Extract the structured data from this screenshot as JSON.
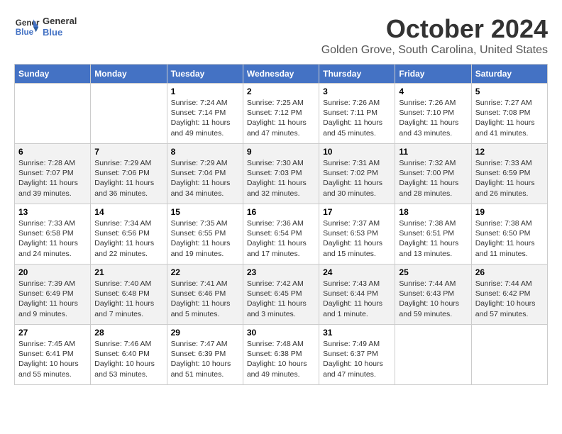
{
  "header": {
    "logo_line1": "General",
    "logo_line2": "Blue",
    "month": "October 2024",
    "location": "Golden Grove, South Carolina, United States"
  },
  "weekdays": [
    "Sunday",
    "Monday",
    "Tuesday",
    "Wednesday",
    "Thursday",
    "Friday",
    "Saturday"
  ],
  "weeks": [
    [
      {
        "day": "",
        "info": ""
      },
      {
        "day": "",
        "info": ""
      },
      {
        "day": "1",
        "info": "Sunrise: 7:24 AM\nSunset: 7:14 PM\nDaylight: 11 hours and 49 minutes."
      },
      {
        "day": "2",
        "info": "Sunrise: 7:25 AM\nSunset: 7:12 PM\nDaylight: 11 hours and 47 minutes."
      },
      {
        "day": "3",
        "info": "Sunrise: 7:26 AM\nSunset: 7:11 PM\nDaylight: 11 hours and 45 minutes."
      },
      {
        "day": "4",
        "info": "Sunrise: 7:26 AM\nSunset: 7:10 PM\nDaylight: 11 hours and 43 minutes."
      },
      {
        "day": "5",
        "info": "Sunrise: 7:27 AM\nSunset: 7:08 PM\nDaylight: 11 hours and 41 minutes."
      }
    ],
    [
      {
        "day": "6",
        "info": "Sunrise: 7:28 AM\nSunset: 7:07 PM\nDaylight: 11 hours and 39 minutes."
      },
      {
        "day": "7",
        "info": "Sunrise: 7:29 AM\nSunset: 7:06 PM\nDaylight: 11 hours and 36 minutes."
      },
      {
        "day": "8",
        "info": "Sunrise: 7:29 AM\nSunset: 7:04 PM\nDaylight: 11 hours and 34 minutes."
      },
      {
        "day": "9",
        "info": "Sunrise: 7:30 AM\nSunset: 7:03 PM\nDaylight: 11 hours and 32 minutes."
      },
      {
        "day": "10",
        "info": "Sunrise: 7:31 AM\nSunset: 7:02 PM\nDaylight: 11 hours and 30 minutes."
      },
      {
        "day": "11",
        "info": "Sunrise: 7:32 AM\nSunset: 7:00 PM\nDaylight: 11 hours and 28 minutes."
      },
      {
        "day": "12",
        "info": "Sunrise: 7:33 AM\nSunset: 6:59 PM\nDaylight: 11 hours and 26 minutes."
      }
    ],
    [
      {
        "day": "13",
        "info": "Sunrise: 7:33 AM\nSunset: 6:58 PM\nDaylight: 11 hours and 24 minutes."
      },
      {
        "day": "14",
        "info": "Sunrise: 7:34 AM\nSunset: 6:56 PM\nDaylight: 11 hours and 22 minutes."
      },
      {
        "day": "15",
        "info": "Sunrise: 7:35 AM\nSunset: 6:55 PM\nDaylight: 11 hours and 19 minutes."
      },
      {
        "day": "16",
        "info": "Sunrise: 7:36 AM\nSunset: 6:54 PM\nDaylight: 11 hours and 17 minutes."
      },
      {
        "day": "17",
        "info": "Sunrise: 7:37 AM\nSunset: 6:53 PM\nDaylight: 11 hours and 15 minutes."
      },
      {
        "day": "18",
        "info": "Sunrise: 7:38 AM\nSunset: 6:51 PM\nDaylight: 11 hours and 13 minutes."
      },
      {
        "day": "19",
        "info": "Sunrise: 7:38 AM\nSunset: 6:50 PM\nDaylight: 11 hours and 11 minutes."
      }
    ],
    [
      {
        "day": "20",
        "info": "Sunrise: 7:39 AM\nSunset: 6:49 PM\nDaylight: 11 hours and 9 minutes."
      },
      {
        "day": "21",
        "info": "Sunrise: 7:40 AM\nSunset: 6:48 PM\nDaylight: 11 hours and 7 minutes."
      },
      {
        "day": "22",
        "info": "Sunrise: 7:41 AM\nSunset: 6:46 PM\nDaylight: 11 hours and 5 minutes."
      },
      {
        "day": "23",
        "info": "Sunrise: 7:42 AM\nSunset: 6:45 PM\nDaylight: 11 hours and 3 minutes."
      },
      {
        "day": "24",
        "info": "Sunrise: 7:43 AM\nSunset: 6:44 PM\nDaylight: 11 hours and 1 minute."
      },
      {
        "day": "25",
        "info": "Sunrise: 7:44 AM\nSunset: 6:43 PM\nDaylight: 10 hours and 59 minutes."
      },
      {
        "day": "26",
        "info": "Sunrise: 7:44 AM\nSunset: 6:42 PM\nDaylight: 10 hours and 57 minutes."
      }
    ],
    [
      {
        "day": "27",
        "info": "Sunrise: 7:45 AM\nSunset: 6:41 PM\nDaylight: 10 hours and 55 minutes."
      },
      {
        "day": "28",
        "info": "Sunrise: 7:46 AM\nSunset: 6:40 PM\nDaylight: 10 hours and 53 minutes."
      },
      {
        "day": "29",
        "info": "Sunrise: 7:47 AM\nSunset: 6:39 PM\nDaylight: 10 hours and 51 minutes."
      },
      {
        "day": "30",
        "info": "Sunrise: 7:48 AM\nSunset: 6:38 PM\nDaylight: 10 hours and 49 minutes."
      },
      {
        "day": "31",
        "info": "Sunrise: 7:49 AM\nSunset: 6:37 PM\nDaylight: 10 hours and 47 minutes."
      },
      {
        "day": "",
        "info": ""
      },
      {
        "day": "",
        "info": ""
      }
    ]
  ]
}
